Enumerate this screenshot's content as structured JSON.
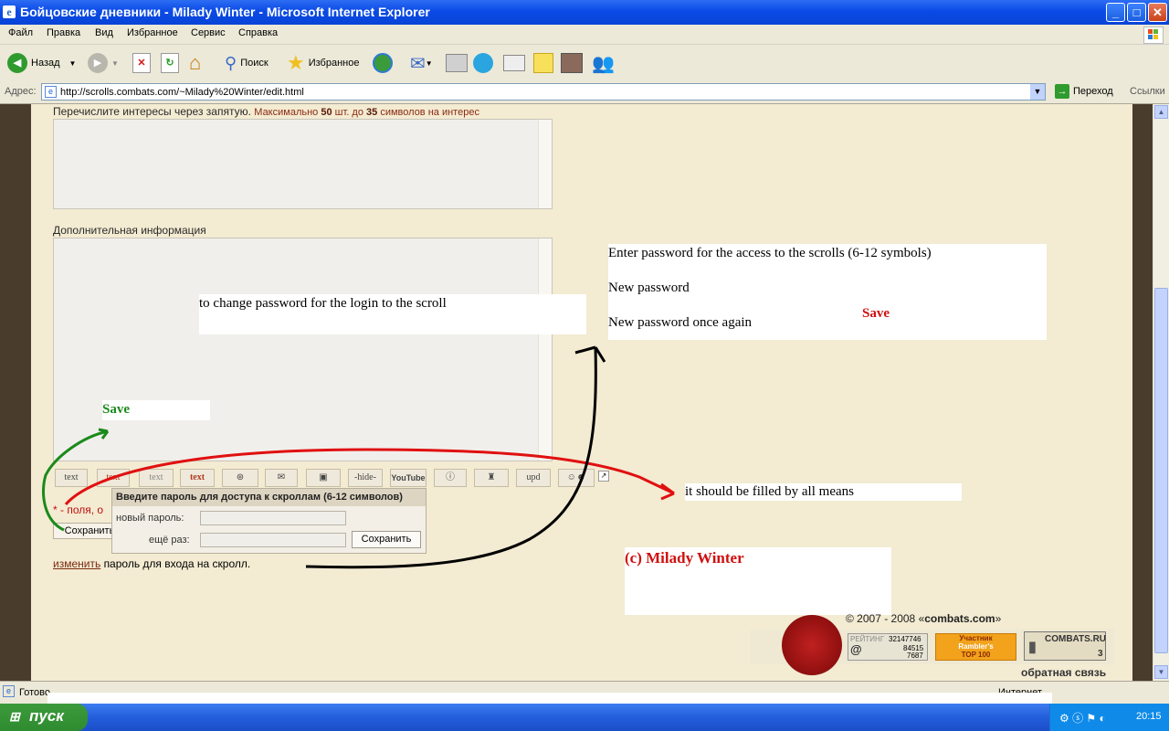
{
  "window": {
    "title": "Бойцовские дневники - Milady Winter - Microsoft Internet Explorer",
    "minimize": "_",
    "maximize": "□",
    "close": "✕"
  },
  "menu": [
    "Файл",
    "Правка",
    "Вид",
    "Избранное",
    "Сервис",
    "Справка"
  ],
  "toolbar": {
    "back_label": "Назад",
    "search_label": "Поиск",
    "favorites_label": "Избранное"
  },
  "address": {
    "label": "Адрес:",
    "url": "http://scrolls.combats.com/~Milady%20Winter/edit.html",
    "go_label": "Переход",
    "links_label": "Ссылки"
  },
  "form": {
    "interests_label": "Перечислите интересы через запятую.",
    "interests_hint_pre": "Максимально",
    "interests_max": "50",
    "interests_hint_mid": "шт. до",
    "interests_chars": "35",
    "interests_hint_post": "символов на интерес",
    "extra_label": "Дополнительная информация",
    "tool_buttons": [
      "text",
      "text",
      "text",
      "text",
      "",
      "",
      "",
      "-hide-",
      "YouTube",
      "",
      "",
      "upd",
      ""
    ],
    "required_note_star": "*",
    "required_note": "- поля, о",
    "save_button": "Сохранить",
    "change_link": "изменить",
    "change_text": "пароль для входа на скролл."
  },
  "popup": {
    "header": "Введите пароль для доступа к скроллам (6-12 символов)",
    "new_password_label": "новый пароль:",
    "again_label": "ещё раз:",
    "save_button": "Сохранить"
  },
  "annotations": {
    "change_password": "to change password for the login to the scroll",
    "save_green": "Save",
    "enter_password": "Enter password for the access to the scrolls (6-12 symbols)",
    "new_password": "New password",
    "new_password_again": "New password once again",
    "save_red": "Save",
    "required": "it should be filled by all means",
    "credit": "(c) Milady Winter"
  },
  "footer": {
    "copyright_pre": "© 2007 - 2008 «",
    "copyright_site": "combats.com",
    "copyright_post": "»",
    "feedback": "обратная связь",
    "mailru_rating": "РЕЙТИНГ",
    "mailru_id": "32147746",
    "mailru_n1": "84515",
    "mailru_n2": "7687",
    "rambler_line1": "Участник",
    "rambler_line2": "Rambler's",
    "rambler_line3": "TOP 100",
    "combats_badge": "COMBATS.RU",
    "combats_count": "3"
  },
  "status": {
    "text": "Готово",
    "zone": "Интернет"
  },
  "taskbar": {
    "start": "пуск",
    "clock": "20:15"
  },
  "colors": {
    "red_annotation": "#e01010",
    "green_annotation": "#1a8a1a",
    "black_annotation": "#000000"
  }
}
